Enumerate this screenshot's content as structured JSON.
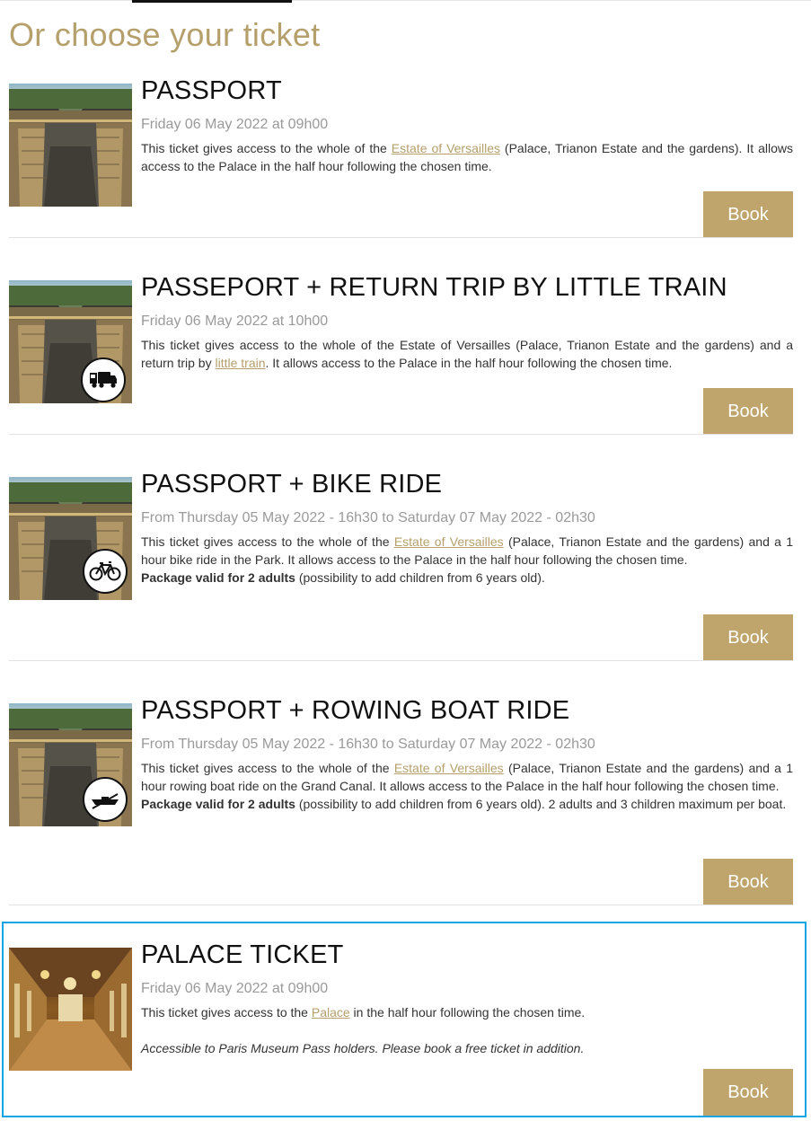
{
  "section_title": "Or choose your ticket",
  "link_color": "#b59f6b",
  "button_color": "#bfa46c",
  "highlight_color": "#13a4e2",
  "tickets": [
    {
      "name": "PASSPORT",
      "date": "Friday 06 May 2022 at 09h00",
      "desc1_pre": "This ticket gives access to the whole of the ",
      "desc1_link": "Estate of Versailles",
      "desc1_post": " (Palace, Trianon Estate and the gardens). It allows access to the Palace in the half hour following the chosen time.",
      "book_label": "Book",
      "icon": "palace-photo"
    },
    {
      "name": "PASSEPORT + RETURN TRIP BY LITTLE TRAIN",
      "date": "Friday 06 May 2022 at 10h00",
      "desc1_pre": "This ticket gives access to the whole of the Estate of Versailles (Palace, Trianon Estate and the gardens) and a return trip by ",
      "desc1_link": "little train",
      "desc1_post": ". It allows access to the Palace in the half hour following the chosen time.",
      "book_label": "Book",
      "icon": "train-icon"
    },
    {
      "name": "PASSPORT + BIKE RIDE",
      "date": "From Thursday 05 May 2022 - 16h30 to Saturday 07 May 2022 - 02h30",
      "desc1_pre": "This ticket gives access to the whole of the ",
      "desc1_link": "Estate of Versailles",
      "desc1_post": " (Palace, Trianon Estate and the gardens) and a 1 hour bike ride in the Park. It allows access to the Palace in the half hour following the chosen time.",
      "desc2_bold": "Package valid for 2 adults",
      "desc2_rest": " (possibility to add children from 6 years old).",
      "book_label": "Book",
      "icon": "bike-icon"
    },
    {
      "name": "PASSPORT + ROWING BOAT RIDE",
      "date": "From Thursday 05 May 2022 - 16h30 to Saturday 07 May 2022 - 02h30",
      "desc1_pre": "This ticket gives access to the whole of the ",
      "desc1_link": "Estate of Versailles",
      "desc1_post": " (Palace, Trianon Estate and the gardens) and a 1 hour rowing boat ride on the Grand Canal. It allows access to the Palace in the half hour following the chosen time.",
      "desc2_bold": "Package valid for 2 adults",
      "desc2_rest": " (possibility to add children from 6 years old). 2 adults and 3 children maximum per boat.",
      "book_label": "Book",
      "icon": "rowing-boat-icon"
    },
    {
      "name": "PALACE TICKET",
      "date": "Friday 06 May 2022 at 09h00",
      "desc1_pre": "This ticket gives access to the ",
      "desc1_link": "Palace",
      "desc1_post": " in the half hour following the chosen time.",
      "desc2_italic": "Accessible to Paris Museum Pass holders. Please book a free ticket in addition.",
      "book_label": "Book",
      "icon": "hall-of-mirrors-photo"
    }
  ]
}
